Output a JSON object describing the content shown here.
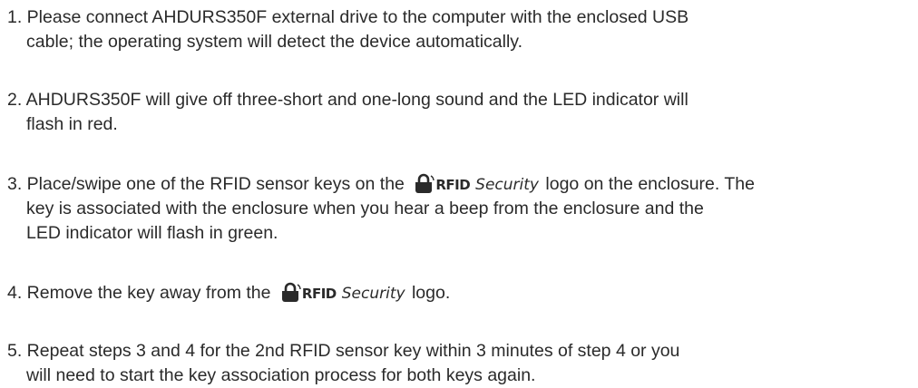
{
  "steps": [
    {
      "lines": [
        "1. Please connect AHDURS350F external drive to the computer with the enclosed USB",
        "cable; the operating system will detect the device automatically."
      ]
    },
    {
      "lines": [
        "2. AHDURS350F will give off three-short and one-long sound and the LED indicator will",
        "flash in red."
      ]
    },
    {
      "line1_before_logo": "3. Place/swipe one of the RFID sensor keys on the",
      "line1_after_logo": "logo on the enclosure. The",
      "lines_rest": [
        "key is associated with the enclosure when you hear a beep from the enclosure and the",
        "LED indicator will flash in green."
      ]
    },
    {
      "before_logo": "4. Remove the key away from the",
      "after_logo": "logo."
    },
    {
      "lines": [
        "5. Repeat steps 3 and 4 for the 2nd RFID sensor key within 3 minutes of step 4 or you",
        "will need to start the key association process for both keys again."
      ]
    }
  ],
  "logo": {
    "brand": "RFID",
    "word": "Security",
    "icon": "lock-icon"
  }
}
